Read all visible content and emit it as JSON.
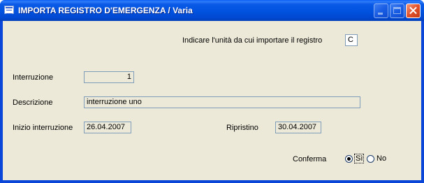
{
  "window": {
    "title": "IMPORTA REGISTRO D'EMERGENZA / Varia",
    "icon": "app-window-icon",
    "buttons": {
      "minimize": "minimize-icon",
      "maximize": "maximize-icon",
      "close": "close-icon"
    }
  },
  "form": {
    "drive_prompt": "Indicare l'unità da cui importare il registro",
    "drive_value": "C",
    "interruption_label": "Interruzione",
    "interruption_value": "1",
    "description_label": "Descrizione",
    "description_value": "interruzione uno",
    "start_label": "Inizio interruzione",
    "start_value": "26.04.2007",
    "restore_label": "Ripristino",
    "restore_value": "30.04.2007",
    "confirm_label": "Conferma",
    "confirm_options": [
      {
        "label": "Sì",
        "selected": true
      },
      {
        "label": "No",
        "selected": false
      }
    ]
  },
  "colors": {
    "titlebar": "#0052df",
    "client_bg": "#ece9d8",
    "field_border": "#7f9db9"
  }
}
